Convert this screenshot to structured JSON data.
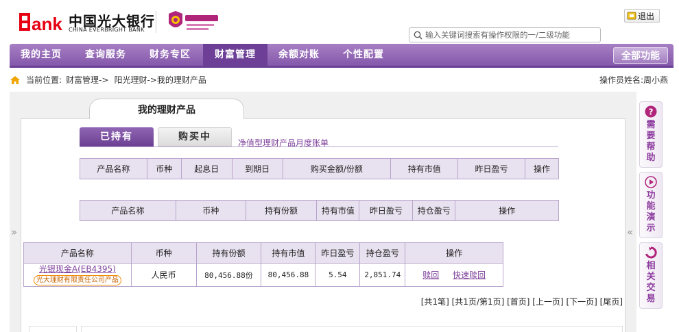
{
  "header": {
    "bank_cn": "中国光大银行",
    "bank_en": "CHINA EVERBRIGHT BANK",
    "logout": "退出",
    "search_placeholder": "输入关键词搜索有操作权限的一/二级功能"
  },
  "colors": {
    "brand_purple": "#8458ab",
    "active_tab": "#6d3f97",
    "link": "#7d3f9a",
    "logo_red": "#e60012"
  },
  "nav": {
    "items": [
      "我的主页",
      "查询服务",
      "财务专区",
      "财富管理",
      "余额对账",
      "个性配置"
    ],
    "active": "财富管理",
    "all_functions": "全部功能"
  },
  "breadcrumb": {
    "prefix": "当前位置:",
    "level1": "财富管理->",
    "level2": "阳光理财->我的理财产品"
  },
  "operator": "操作员姓名:周小燕",
  "page_tab": "我的理财产品",
  "tabs": {
    "held": "已持有",
    "buying": "购买中"
  },
  "statement_link": "净值型理财产品月度账单",
  "table1": {
    "headers": [
      "产品名称",
      "币种",
      "起息日",
      "到期日",
      "购买金额/份额",
      "持有市值",
      "昨日盈亏",
      "操作"
    ]
  },
  "table2": {
    "headers": [
      "产品名称",
      "币种",
      "持有份额",
      "持有市值",
      "昨日盈亏",
      "持仓盈亏",
      "操作"
    ]
  },
  "table3": {
    "headers": [
      "产品名称",
      "币种",
      "持有份额",
      "持有市值",
      "昨日盈亏",
      "持仓盈亏",
      "操作"
    ],
    "rows": [
      {
        "name": "光银现金A(EB4395)",
        "issuer": "光大理财有限责任公司产品",
        "currency": "人民币",
        "shares": "80,456.88份",
        "market_value": "80,456.88",
        "yesterday_pl": "5.54",
        "position_pl": "2,851.74",
        "actions": [
          "赎回",
          "快速赎回"
        ]
      }
    ]
  },
  "pager": "[共1笔] [共1页/第1页] [首页] [上一页] [下一页] [尾页]",
  "side_arrows": {
    "left": "»",
    "right": "«"
  },
  "right_panel": [
    {
      "label_chars": [
        "需",
        "要",
        "帮",
        "助"
      ],
      "icon": "question-icon"
    },
    {
      "label_chars": [
        "功",
        "能",
        "演",
        "示"
      ],
      "icon": "play-icon"
    },
    {
      "label_chars": [
        "相",
        "关",
        "交",
        "易"
      ],
      "icon": "refresh-icon"
    }
  ]
}
